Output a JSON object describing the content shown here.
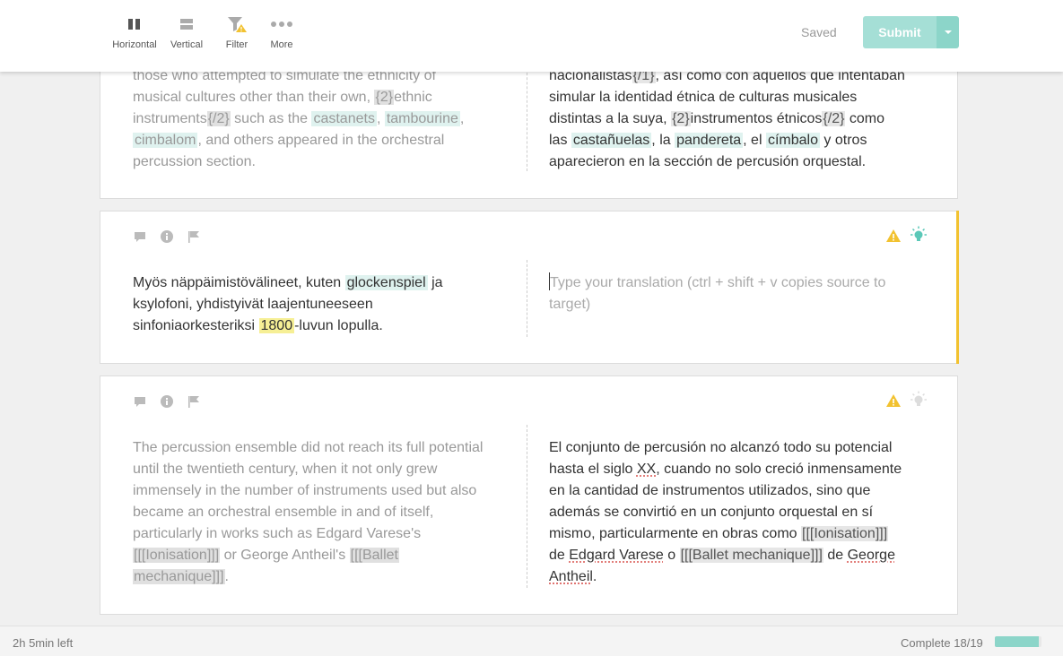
{
  "toolbar": {
    "horizontal": "Horizontal",
    "vertical": "Vertical",
    "filter": "Filter",
    "more": "More",
    "saved": "Saved",
    "submit": "Submit"
  },
  "segments": [
    {
      "source": {
        "l1": "those who attempted to simulate the ethnicity of",
        "l2": "musical cultures other than their own, ",
        "tag1": "{2}",
        "l2b": "ethnic",
        "l3": "instruments",
        "tag2": "{/2}",
        "l3b": " such as the ",
        "t1": "castanets",
        "c1": ", ",
        "t2": "tambourine",
        "c2": ",",
        "t3": "cimbalom",
        "l4": ", and others appeared in the orchestral",
        "l5": "percussion section."
      },
      "target": {
        "l1a": "nacionalistas",
        "tag0": "{/1}",
        "l1b": ", así como con aquellos que intentaban",
        "l2": "simular la identidad étnica de culturas musicales",
        "l3a": "distintas a la suya, ",
        "tag1": "{2}",
        "l3b": "instrumentos étnicos",
        "tag2": "{/2}",
        "l3c": " como",
        "l4a": "las ",
        "t1": "castañuelas",
        "l4b": ", la ",
        "t2": "pandereta",
        "l4c": ", el ",
        "t3": "címbalo",
        "l4d": " y otros",
        "l5": "aparecieron en la sección de percusión orquestal."
      }
    },
    {
      "source": {
        "l1a": "Myös näppäimistövälineet, kuten ",
        "t1": "glockenspiel",
        "l1b": " ja",
        "l2": "ksylofoni, yhdistyivät laajentuneeseen",
        "l3a": "sinfoniaorkesteriksi ",
        "n1": "1800",
        "l3b": "-luvun lopulla."
      },
      "target": {
        "placeholder": "Type your translation (ctrl + shift + v copies source to target)"
      }
    },
    {
      "source": {
        "l1": "The percussion ensemble did not reach its full potential",
        "l2": "until the twentieth century, when it not only grew",
        "l3": "immensely in the number of instruments used but also",
        "l4": "became an orchestral ensemble in and of itself,",
        "l5": "particularly in works such as Edgard Varese's",
        "tag1": "[[[Ionisation]]]",
        "l6b": " or George Antheil's ",
        "tag2a": "[[[Ballet",
        "tag2b": "mechanique]]]",
        "l7b": "."
      },
      "target": {
        "l1": "El conjunto de percusión no alcanzó todo su potencial",
        "l2a": "hasta el siglo ",
        "s1": "XX",
        "l2b": ", cuando no solo creció inmensamente",
        "l3": "en la cantidad de instrumentos utilizados, sino que",
        "l4": "además se convirtió en un conjunto orquestal en sí",
        "l5a": "mismo, particularmente en obras como ",
        "tag1": "[[[Ionisation]]]",
        "l6a": "de ",
        "s2": "Edgard Varese",
        "l6b": " o ",
        "tag2": "[[[Ballet mechanique]]]",
        "l6c": " de ",
        "s3": "George",
        "s4": "Antheil",
        "l7b": "."
      }
    }
  ],
  "footer": {
    "time_left": "2h 5min left",
    "complete": "Complete 18/19",
    "progress": 0.947
  },
  "colors": {
    "accent": "#a5dfd6",
    "active_bar": "#f2c230",
    "warning": "#f2c230"
  }
}
